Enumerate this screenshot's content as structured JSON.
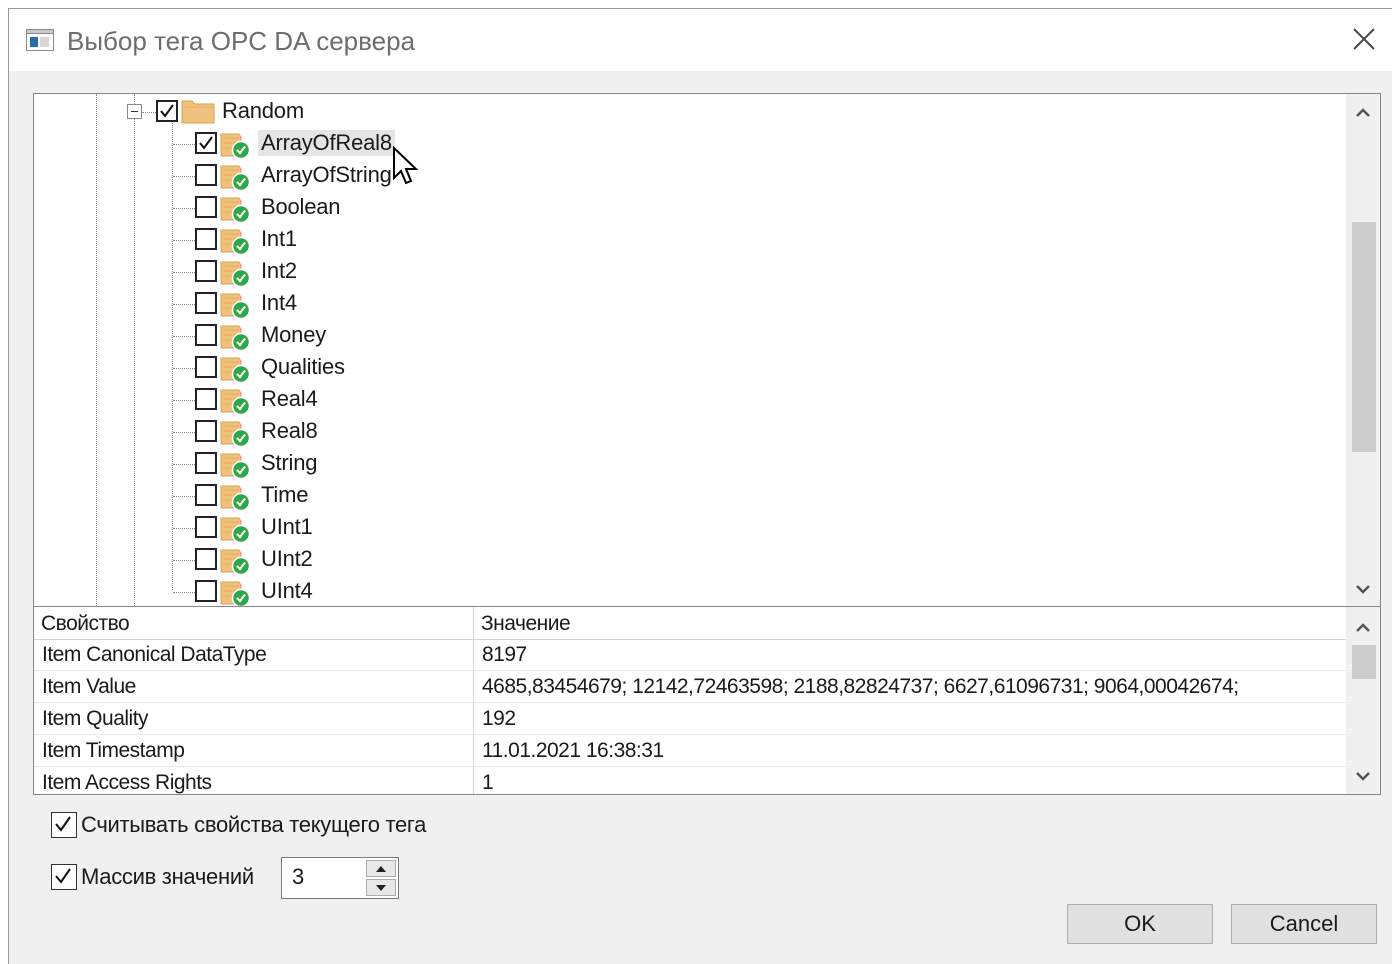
{
  "window": {
    "title": "Выбор тега OPC DA сервера"
  },
  "tree": {
    "parent": {
      "label": "Random",
      "checked": true,
      "expanded": true
    },
    "items": [
      {
        "label": "ArrayOfReal8",
        "checked": true,
        "selected": true
      },
      {
        "label": "ArrayOfString",
        "checked": false
      },
      {
        "label": "Boolean",
        "checked": false
      },
      {
        "label": "Int1",
        "checked": false
      },
      {
        "label": "Int2",
        "checked": false
      },
      {
        "label": "Int4",
        "checked": false
      },
      {
        "label": "Money",
        "checked": false
      },
      {
        "label": "Qualities",
        "checked": false
      },
      {
        "label": "Real4",
        "checked": false
      },
      {
        "label": "Real8",
        "checked": false
      },
      {
        "label": "String",
        "checked": false
      },
      {
        "label": "Time",
        "checked": false
      },
      {
        "label": "UInt1",
        "checked": false
      },
      {
        "label": "UInt2",
        "checked": false
      },
      {
        "label": "UInt4",
        "checked": false
      }
    ]
  },
  "properties": {
    "columns": [
      "Свойство",
      "Значение"
    ],
    "rows": [
      [
        "Item Canonical DataType",
        "8197"
      ],
      [
        "Item Value",
        "4685,83454679; 12142,72463598; 2188,82824737; 6627,61096731; 9064,00042674;"
      ],
      [
        "Item Quality",
        "192"
      ],
      [
        "Item Timestamp",
        "11.01.2021 16:38:31"
      ],
      [
        "Item Access Rights",
        "1"
      ]
    ]
  },
  "options": {
    "read_props": {
      "label": "Считывать свойства текущего тега",
      "checked": true
    },
    "value_array": {
      "label": "Массив значений",
      "checked": true,
      "count": "3"
    }
  },
  "buttons": {
    "ok": "OK",
    "cancel": "Cancel"
  },
  "colors": {
    "folder": "#f1c27d",
    "ok_badge": "#2aa84a",
    "text": "#1a1a1a"
  }
}
